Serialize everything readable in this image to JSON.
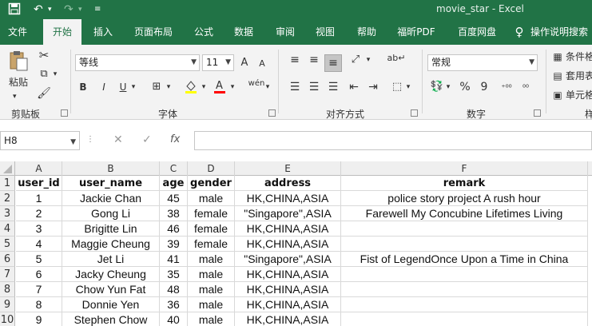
{
  "titlebar": {
    "save_icon": "save-icon",
    "undo_icon": "undo-icon",
    "redo_icon": "redo-icon",
    "customize_icon": "customize-qat-icon",
    "title": "movie_star  -  Excel"
  },
  "tabs": [
    "文件",
    "开始",
    "插入",
    "页面布局",
    "公式",
    "数据",
    "审阅",
    "视图",
    "帮助",
    "福昕PDF",
    "百度网盘",
    "操作说明搜索"
  ],
  "ribbon": {
    "clipboard": {
      "paste": "粘贴",
      "label": "剪贴板"
    },
    "font": {
      "name": "等线",
      "size": "11",
      "bold": "B",
      "italic": "I",
      "underline": "U",
      "grow": "A",
      "shrink": "A",
      "wen": "wén",
      "label": "字体"
    },
    "alignment": {
      "label": "对齐方式"
    },
    "number": {
      "format": "常规",
      "percent": "%",
      "comma": "9",
      "label": "数字"
    },
    "styles": {
      "conditional": "条件格",
      "table": "套用表",
      "cell": "单元格",
      "label": "样"
    }
  },
  "formula_bar": {
    "name_box": "H8",
    "fx": "fx",
    "value": ""
  },
  "grid": {
    "columns": [
      "A",
      "B",
      "C",
      "D",
      "E",
      "F"
    ],
    "rows": [
      {
        "num": "1",
        "cells": [
          "user_id",
          "user_name",
          "age",
          "gender",
          "address",
          "remark"
        ]
      },
      {
        "num": "2",
        "cells": [
          "1",
          "Jackie Chan",
          "45",
          "male",
          "HK,CHINA,ASIA",
          "police story project A rush hour"
        ]
      },
      {
        "num": "3",
        "cells": [
          "2",
          "Gong Li",
          "38",
          "female",
          "\"Singapore\",ASIA",
          "Farewell My Concubine Lifetimes Living"
        ]
      },
      {
        "num": "4",
        "cells": [
          "3",
          "Brigitte Lin",
          "46",
          "female",
          "HK,CHINA,ASIA",
          ""
        ]
      },
      {
        "num": "5",
        "cells": [
          "4",
          "Maggie Cheung",
          "39",
          "female",
          "HK,CHINA,ASIA",
          ""
        ]
      },
      {
        "num": "6",
        "cells": [
          "5",
          "Jet Li",
          "41",
          "male",
          "\"Singapore\",ASIA",
          "Fist of LegendOnce Upon a Time in China"
        ]
      },
      {
        "num": "7",
        "cells": [
          "6",
          "Jacky Cheung",
          "35",
          "male",
          "HK,CHINA,ASIA",
          ""
        ]
      },
      {
        "num": "8",
        "cells": [
          "7",
          "Chow Yun Fat",
          "48",
          "male",
          "HK,CHINA,ASIA",
          ""
        ]
      },
      {
        "num": "9",
        "cells": [
          "8",
          "Donnie Yen",
          "36",
          "male",
          "HK,CHINA,ASIA",
          ""
        ]
      },
      {
        "num": "10",
        "cells": [
          "9",
          "Stephen Chow",
          "40",
          "male",
          "HK,CHINA,ASIA",
          ""
        ]
      }
    ]
  },
  "colors": {
    "brand": "#217346",
    "ribbon_bg": "#f3f3f3",
    "header_bg": "#efefef"
  }
}
